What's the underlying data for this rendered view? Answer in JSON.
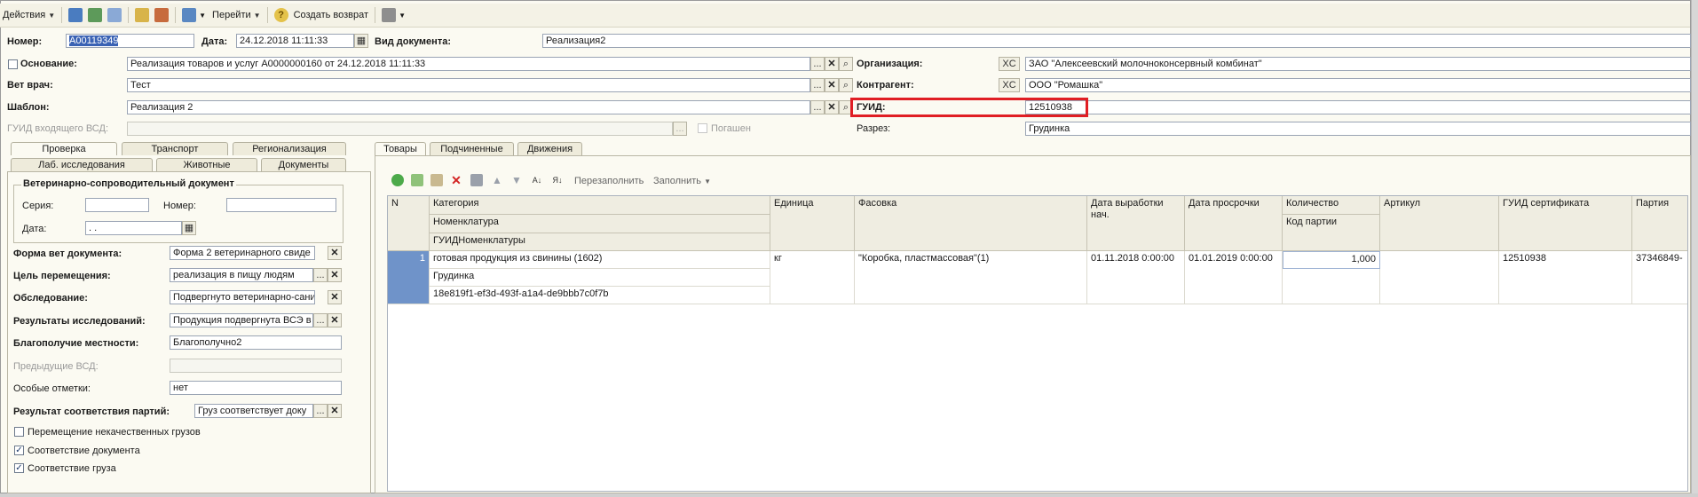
{
  "toolbar": {
    "actions": "Действия",
    "goto": "Перейти",
    "create_return": "Создать возврат"
  },
  "header": {
    "number_label": "Номер:",
    "number_value": "А00119349",
    "date_label": "Дата:",
    "date_value": "24.12.2018 11:11:33",
    "doctype_label": "Вид документа:",
    "doctype_value": "Реализация2",
    "basis_label": "Основание:",
    "basis_value": "Реализация товаров и услуг А0000000160 от 24.12.2018 11:11:33",
    "vet_label": "Вет врач:",
    "vet_value": "Тест",
    "template_label": "Шаблон:",
    "template_value": "Реализация 2",
    "guid_in_label": "ГУИД входящего ВСД:",
    "guid_in_value": "",
    "paid_label": "Погашен",
    "org_label": "Организация:",
    "org_value": "ЗАО \"Алексеевский молочноконсервный комбинат\"",
    "contr_label": "Контрагент:",
    "contr_value": "ООО \"Ромашка\"",
    "xc": "XC",
    "guid_label": "ГУИД:",
    "guid_value": "12510938",
    "razrez_label": "Разрез:",
    "razrez_value": "Грудинка"
  },
  "left_tabs": {
    "row1": [
      "Проверка",
      "Транспорт",
      "Регионализация"
    ],
    "row2": [
      "Лаб. исследования",
      "Животные",
      "Документы"
    ]
  },
  "left": {
    "group_title": "Ветеринарно-сопроводительный документ",
    "series_label": "Серия:",
    "series_value": "",
    "number_label": "Номер:",
    "number_value": "",
    "date_label": "Дата:",
    "date_value": " .  .",
    "form_label": "Форма вет документа:",
    "form_value": "Форма 2 ветеринарного свиде",
    "purpose_label": "Цель перемещения:",
    "purpose_value": "реализация в пищу людям",
    "exam_label": "Обследование:",
    "exam_value": "Подвергнуто ветеринарно-сани",
    "results_label": "Результаты исследований:",
    "results_value": "Продукция подвергнута ВСЭ в",
    "welfare_label": "Благополучие местности:",
    "welfare_value": "Благополучно2",
    "prev_label": "Предыдущие ВСД:",
    "prev_value": "",
    "notes_label": "Особые отметки:",
    "notes_value": "нет",
    "match_label": "Результат соответствия партий:",
    "match_value": "Груз соответствует доку",
    "cb_bad_label": "Перемещение некачественных грузов",
    "cb_doc_label": "Соответствие документа",
    "cb_cargo_label": "Соответствие груза",
    "ellipsis": "...",
    "x": "✕"
  },
  "right_tabs": [
    "Товары",
    "Подчиненные",
    "Движения"
  ],
  "grid_toolbar": {
    "refill": "Перезаполнить",
    "fill": "Заполнить"
  },
  "grid": {
    "headers": {
      "n": "N",
      "category": "Категория",
      "nomenclature": "Номенклатура",
      "guid_nom": "ГУИДНоменклатуры",
      "unit": "Единица",
      "packing": "Фасовка",
      "prod_date": "Дата выработки нач.",
      "exp_date": "Дата просрочки",
      "qty": "Количество",
      "batch_code": "Код партии",
      "article": "Артикул",
      "cert_guid": "ГУИД сертификата",
      "batch": "Партия"
    },
    "row": {
      "n": "1",
      "category": "готовая продукция из свинины (1602)",
      "nomenclature": "Грудинка",
      "guid_nom": "18e819f1-ef3d-493f-a1a4-de9bbb7c0f7b",
      "unit": "кг",
      "packing": "\"Коробка, пластмассовая\"(1)",
      "prod_date": "01.11.2018 0:00:00",
      "exp_date": "01.01.2019 0:00:00",
      "qty": "1,000",
      "batch_code": "",
      "article": "",
      "cert_guid": "12510938",
      "batch": "37346849-"
    }
  }
}
